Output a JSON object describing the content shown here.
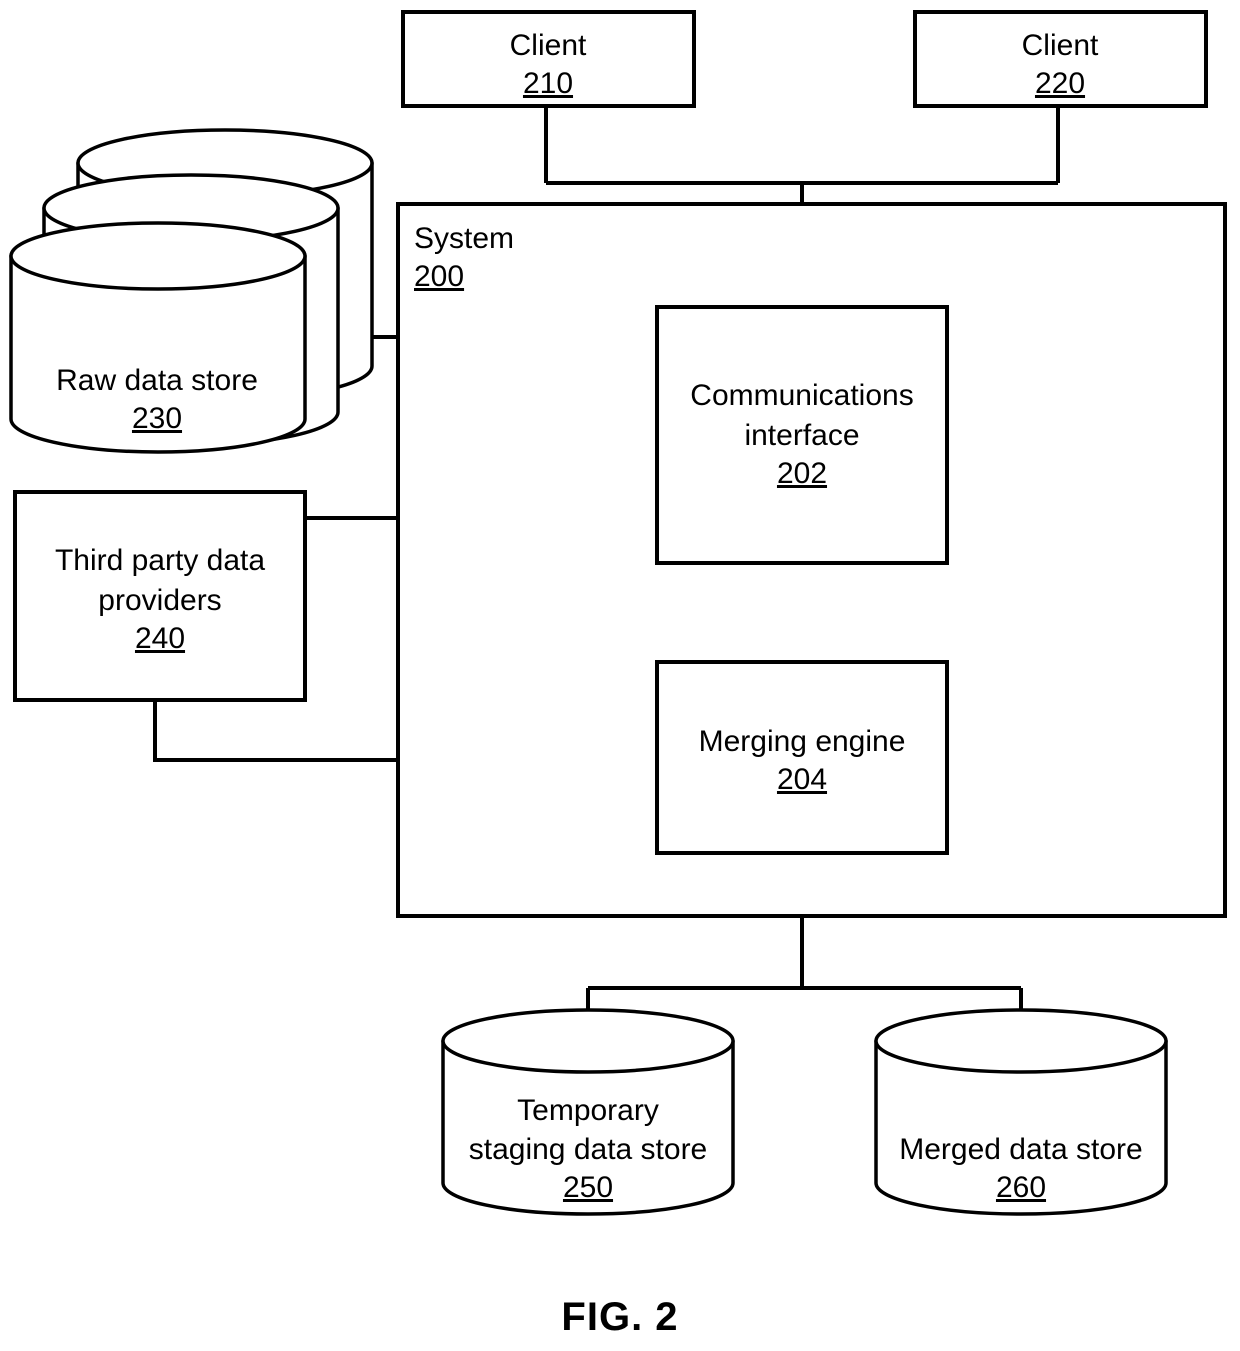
{
  "figure": {
    "caption": "FIG. 2"
  },
  "nodes": {
    "client_a": {
      "label": "Client",
      "ref": "210",
      "shape": "rectangle"
    },
    "client_b": {
      "label": "Client",
      "ref": "220",
      "shape": "rectangle"
    },
    "system": {
      "label": "System",
      "ref": "200",
      "shape": "rectangle"
    },
    "raw_data_store": {
      "label": "Raw data store",
      "ref": "230",
      "shape": "cylinder-stack"
    },
    "third_party": {
      "label_line1": "Third party data",
      "label_line2": "providers",
      "ref": "240",
      "shape": "rectangle"
    },
    "comms_interface": {
      "label_line1": "Communications",
      "label_line2": "interface",
      "ref": "202",
      "shape": "rectangle"
    },
    "merging_engine": {
      "label": "Merging engine",
      "ref": "204",
      "shape": "rectangle"
    },
    "temp_staging": {
      "label_line1": "Temporary",
      "label_line2": "staging data store",
      "ref": "250",
      "shape": "cylinder"
    },
    "merged_store": {
      "label": "Merged data store",
      "ref": "260",
      "shape": "cylinder"
    }
  },
  "colors": {
    "stroke": "#000000",
    "fill": "#ffffff",
    "background": "#ffffff"
  }
}
